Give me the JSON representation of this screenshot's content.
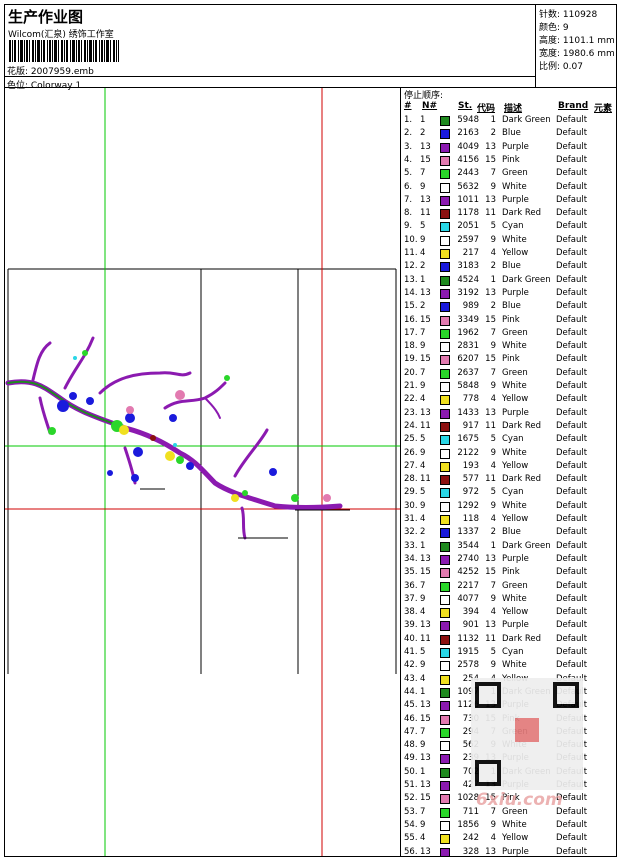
{
  "header": {
    "title": "生产作业图",
    "company": "Wilcom(汇泉) 绣饰工作室",
    "design_label": "花版: 2007959.emb",
    "colorway_label": "色位: Colorway 1"
  },
  "stats": {
    "stitches": "针数: 110928",
    "colors": "颜色: 9",
    "height": "高度: 1101.1 mm",
    "width": "宽度: 1980.6 mm",
    "scale": "比例: 0.07"
  },
  "stop_sequence": {
    "title": "停止顺序:",
    "headers": {
      "idx": "#",
      "n": "N#",
      "st": "St.",
      "code": "代码",
      "desc": "描述",
      "brand": "Brand",
      "element": "元素"
    },
    "rows": [
      [
        "1.",
        "1",
        "#1f8a1f",
        "5948",
        "1",
        "Dark Green",
        "Default"
      ],
      [
        "2.",
        "2",
        "#1a1adc",
        "2163",
        "2",
        "Blue",
        "Default"
      ],
      [
        "3.",
        "13",
        "#8b1ab0",
        "4049",
        "13",
        "Purple",
        "Default"
      ],
      [
        "4.",
        "15",
        "#e27ab0",
        "4156",
        "15",
        "Pink",
        "Default"
      ],
      [
        "5.",
        "7",
        "#2ad62a",
        "2443",
        "7",
        "Green",
        "Default"
      ],
      [
        "6.",
        "9",
        "#ffffff",
        "5632",
        "9",
        "White",
        "Default"
      ],
      [
        "7.",
        "13",
        "#8b1ab0",
        "1011",
        "13",
        "Purple",
        "Default"
      ],
      [
        "8.",
        "11",
        "#8b1010",
        "1178",
        "11",
        "Dark Red",
        "Default"
      ],
      [
        "9.",
        "5",
        "#2ad6e6",
        "2051",
        "5",
        "Cyan",
        "Default"
      ],
      [
        "10.",
        "9",
        "#ffffff",
        "2597",
        "9",
        "White",
        "Default"
      ],
      [
        "11.",
        "4",
        "#f0e020",
        "217",
        "4",
        "Yellow",
        "Default"
      ],
      [
        "12.",
        "2",
        "#1a1adc",
        "3183",
        "2",
        "Blue",
        "Default"
      ],
      [
        "13.",
        "1",
        "#1f8a1f",
        "4524",
        "1",
        "Dark Green",
        "Default"
      ],
      [
        "14.",
        "13",
        "#8b1ab0",
        "3192",
        "13",
        "Purple",
        "Default"
      ],
      [
        "15.",
        "2",
        "#1a1adc",
        "989",
        "2",
        "Blue",
        "Default"
      ],
      [
        "16.",
        "15",
        "#e27ab0",
        "3349",
        "15",
        "Pink",
        "Default"
      ],
      [
        "17.",
        "7",
        "#2ad62a",
        "1962",
        "7",
        "Green",
        "Default"
      ],
      [
        "18.",
        "9",
        "#ffffff",
        "2831",
        "9",
        "White",
        "Default"
      ],
      [
        "19.",
        "15",
        "#e27ab0",
        "6207",
        "15",
        "Pink",
        "Default"
      ],
      [
        "20.",
        "7",
        "#2ad62a",
        "2637",
        "7",
        "Green",
        "Default"
      ],
      [
        "21.",
        "9",
        "#ffffff",
        "5848",
        "9",
        "White",
        "Default"
      ],
      [
        "22.",
        "4",
        "#f0e020",
        "778",
        "4",
        "Yellow",
        "Default"
      ],
      [
        "23.",
        "13",
        "#8b1ab0",
        "1433",
        "13",
        "Purple",
        "Default"
      ],
      [
        "24.",
        "11",
        "#8b1010",
        "917",
        "11",
        "Dark Red",
        "Default"
      ],
      [
        "25.",
        "5",
        "#2ad6e6",
        "1675",
        "5",
        "Cyan",
        "Default"
      ],
      [
        "26.",
        "9",
        "#ffffff",
        "2122",
        "9",
        "White",
        "Default"
      ],
      [
        "27.",
        "4",
        "#f0e020",
        "193",
        "4",
        "Yellow",
        "Default"
      ],
      [
        "28.",
        "11",
        "#8b1010",
        "577",
        "11",
        "Dark Red",
        "Default"
      ],
      [
        "29.",
        "5",
        "#2ad6e6",
        "972",
        "5",
        "Cyan",
        "Default"
      ],
      [
        "30.",
        "9",
        "#ffffff",
        "1292",
        "9",
        "White",
        "Default"
      ],
      [
        "31.",
        "4",
        "#f0e020",
        "118",
        "4",
        "Yellow",
        "Default"
      ],
      [
        "32.",
        "2",
        "#1a1adc",
        "1337",
        "2",
        "Blue",
        "Default"
      ],
      [
        "33.",
        "1",
        "#1f8a1f",
        "3544",
        "1",
        "Dark Green",
        "Default"
      ],
      [
        "34.",
        "13",
        "#8b1ab0",
        "2740",
        "13",
        "Purple",
        "Default"
      ],
      [
        "35.",
        "15",
        "#e27ab0",
        "4252",
        "15",
        "Pink",
        "Default"
      ],
      [
        "36.",
        "7",
        "#2ad62a",
        "2217",
        "7",
        "Green",
        "Default"
      ],
      [
        "37.",
        "9",
        "#ffffff",
        "4077",
        "9",
        "White",
        "Default"
      ],
      [
        "38.",
        "4",
        "#f0e020",
        "394",
        "4",
        "Yellow",
        "Default"
      ],
      [
        "39.",
        "13",
        "#8b1ab0",
        "901",
        "13",
        "Purple",
        "Default"
      ],
      [
        "40.",
        "11",
        "#8b1010",
        "1132",
        "11",
        "Dark Red",
        "Default"
      ],
      [
        "41.",
        "5",
        "#2ad6e6",
        "1915",
        "5",
        "Cyan",
        "Default"
      ],
      [
        "42.",
        "9",
        "#ffffff",
        "2578",
        "9",
        "White",
        "Default"
      ],
      [
        "43.",
        "4",
        "#f0e020",
        "254",
        "4",
        "Yellow",
        "Default"
      ],
      [
        "44.",
        "1",
        "#1f8a1f",
        "1097",
        "1",
        "Dark Green",
        "Default"
      ],
      [
        "45.",
        "13",
        "#8b1ab0",
        "1126",
        "13",
        "Purple",
        "Default"
      ],
      [
        "46.",
        "15",
        "#e27ab0",
        "730",
        "15",
        "Pink",
        "Default"
      ],
      [
        "47.",
        "7",
        "#2ad62a",
        "294",
        "7",
        "Green",
        "Default"
      ],
      [
        "48.",
        "9",
        "#ffffff",
        "562",
        "9",
        "White",
        "Default"
      ],
      [
        "49.",
        "13",
        "#8b1ab0",
        "239",
        "13",
        "Purple",
        "Default"
      ],
      [
        "50.",
        "1",
        "#1f8a1f",
        "702",
        "1",
        "Dark Green",
        "Default"
      ],
      [
        "51.",
        "13",
        "#8b1ab0",
        "427",
        "13",
        "Purple",
        "Default"
      ],
      [
        "52.",
        "15",
        "#e27ab0",
        "1028",
        "15",
        "Pink",
        "Default"
      ],
      [
        "53.",
        "7",
        "#2ad62a",
        "711",
        "7",
        "Green",
        "Default"
      ],
      [
        "54.",
        "9",
        "#ffffff",
        "1856",
        "9",
        "White",
        "Default"
      ],
      [
        "55.",
        "4",
        "#f0e020",
        "242",
        "4",
        "Yellow",
        "Default"
      ],
      [
        "56.",
        "13",
        "#8b1ab0",
        "328",
        "13",
        "Purple",
        "Default"
      ]
    ]
  },
  "watermark": "6xiu.com",
  "colors": {
    "green_guide": "#00c800",
    "red_guide": "#d00000"
  }
}
